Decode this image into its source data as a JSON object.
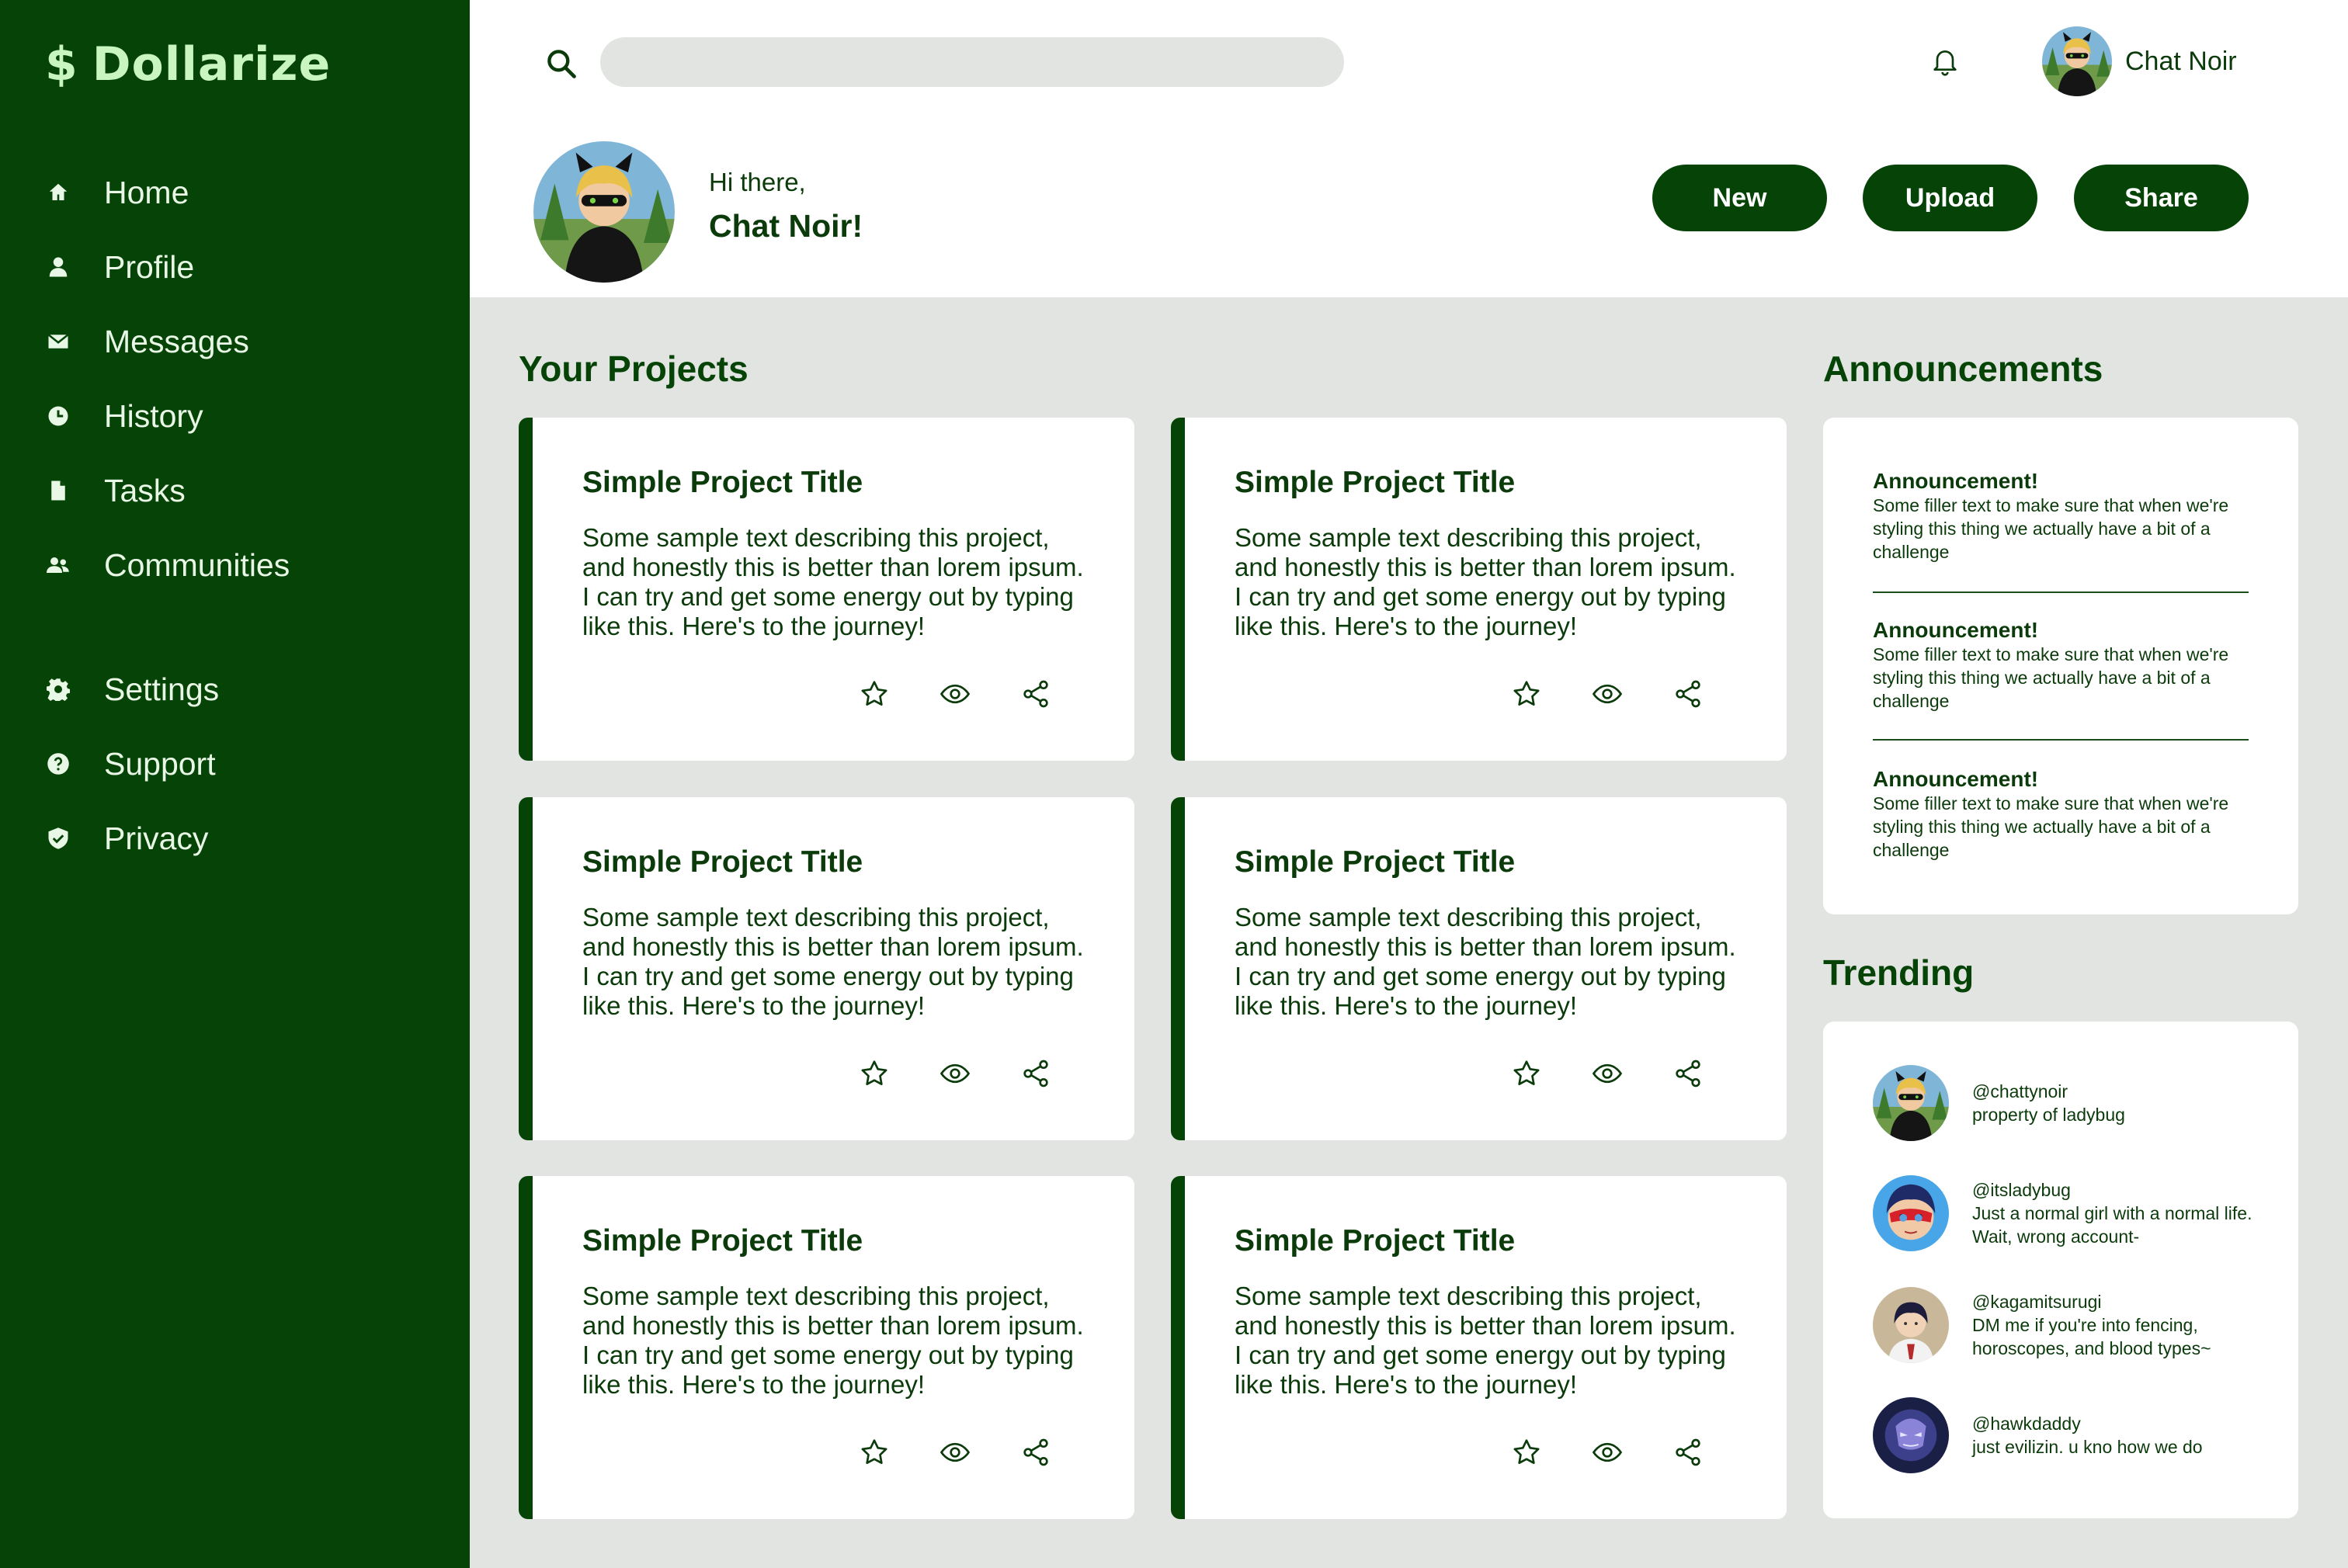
{
  "app": {
    "logo_symbol": "$",
    "logo_text": "Dollarize",
    "accent_color": "#054406",
    "light_accent": "#c8f5c0",
    "background": "#e2e4e1"
  },
  "sidebar": {
    "items": [
      {
        "label": "Home",
        "icon": "home-icon"
      },
      {
        "label": "Profile",
        "icon": "person-icon"
      },
      {
        "label": "Messages",
        "icon": "mail-icon"
      },
      {
        "label": "History",
        "icon": "clock-icon"
      },
      {
        "label": "Tasks",
        "icon": "file-icon"
      },
      {
        "label": "Communities",
        "icon": "people-icon"
      }
    ],
    "secondary": [
      {
        "label": "Settings",
        "icon": "gear-icon"
      },
      {
        "label": "Support",
        "icon": "help-icon"
      },
      {
        "label": "Privacy",
        "icon": "shield-icon"
      }
    ]
  },
  "header": {
    "search_placeholder": "",
    "username": "Chat Noir",
    "greeting": "Hi there,",
    "greeting_name": "Chat Noir!",
    "buttons": {
      "new": "New",
      "upload": "Upload",
      "share": "Share"
    }
  },
  "projects": {
    "heading": "Your Projects",
    "cards": [
      {
        "title": "Simple Project Title",
        "description": "Some sample text describing this project, and honestly this is better than lorem ipsum. I can try and get some energy out by typing like this. Here's to the journey!"
      },
      {
        "title": "Simple Project Title",
        "description": "Some sample text describing this project, and honestly this is better than lorem ipsum. I can try and get some energy out by typing like this. Here's to the journey!"
      },
      {
        "title": "Simple Project Title",
        "description": "Some sample text describing this project, and honestly this is better than lorem ipsum. I can try and get some energy out by typing like this. Here's to the journey!"
      },
      {
        "title": "Simple Project Title",
        "description": "Some sample text describing this project, and honestly this is better than lorem ipsum. I can try and get some energy out by typing like this. Here's to the journey!"
      },
      {
        "title": "Simple Project Title",
        "description": "Some sample text describing this project, and honestly this is better than lorem ipsum. I can try and get some energy out by typing like this. Here's to the journey!"
      },
      {
        "title": "Simple Project Title",
        "description": "Some sample text describing this project, and honestly this is better than lorem ipsum. I can try and get some energy out by typing like this. Here's to the journey!"
      }
    ]
  },
  "announcements": {
    "heading": "Announcements",
    "items": [
      {
        "title": "Announcement!",
        "text": "Some filler text to make sure that when we're styling this thing we actually have a bit of a challenge"
      },
      {
        "title": "Announcement!",
        "text": "Some filler text to make sure that when we're styling this thing we actually have a bit of a challenge"
      },
      {
        "title": "Announcement!",
        "text": "Some filler text to make sure that when we're styling this thing we actually have a bit of a challenge"
      }
    ]
  },
  "trending": {
    "heading": "Trending",
    "items": [
      {
        "handle": "@chattynoir",
        "text": "property of ladybug"
      },
      {
        "handle": "@itsladybug",
        "text": "Just a normal girl with a normal life. Wait, wrong account-"
      },
      {
        "handle": "@kagamitsurugi",
        "text": "DM me if you're into fencing, horoscopes, and blood types~"
      },
      {
        "handle": "@hawkdaddy",
        "text": "just evilizin. u kno how we do"
      }
    ]
  }
}
